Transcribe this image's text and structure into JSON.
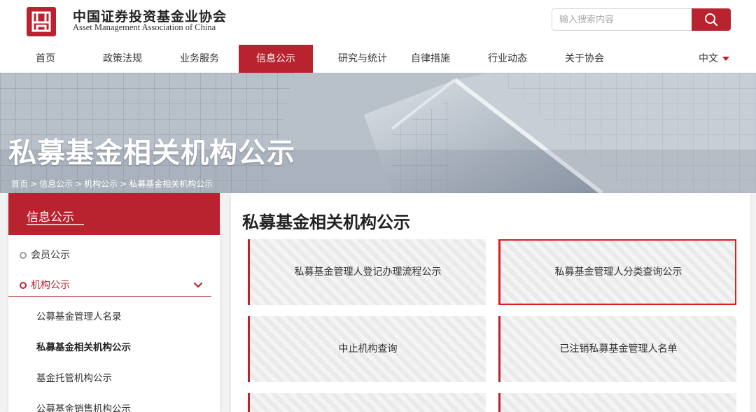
{
  "header": {
    "logo_cn": "中国证券投资基金业协会",
    "logo_en": "Asset Management Association of China",
    "search_placeholder": "输入搜索内容",
    "search_icon": "search-icon"
  },
  "nav": {
    "items": [
      "首页",
      "政策法规",
      "业务服务",
      "信息公示",
      "研究与统计",
      "自律措施",
      "行业动态",
      "关于协会"
    ],
    "active": "信息公示",
    "lang": "中文"
  },
  "banner": {
    "title": "私募基金相关机构公示",
    "breadcrumb": [
      "首页",
      "信息公示",
      "机构公示",
      "私募基金相关机构公示"
    ],
    "separator": ">"
  },
  "sidebar": {
    "heading": "信息公示",
    "items": [
      {
        "label": "会员公示",
        "open": false
      },
      {
        "label": "机构公示",
        "open": true
      }
    ],
    "sub_items": [
      "公募基金管理人名录",
      "私募基金相关机构公示",
      "基金托管机构公示",
      "公募基金销售机构公示"
    ],
    "current_sub": "私募基金相关机构公示"
  },
  "main": {
    "title": "私募基金相关机构公示",
    "cards": [
      "私募基金管理人登记办理流程公示",
      "私募基金管理人分类查询公示",
      "中止机构查询",
      "已注销私募基金管理人名单"
    ],
    "highlighted_card": "私募基金管理人分类查询公示"
  },
  "colors": {
    "brand_red": "#b8232f",
    "highlight_outline": "#e21d1d"
  }
}
